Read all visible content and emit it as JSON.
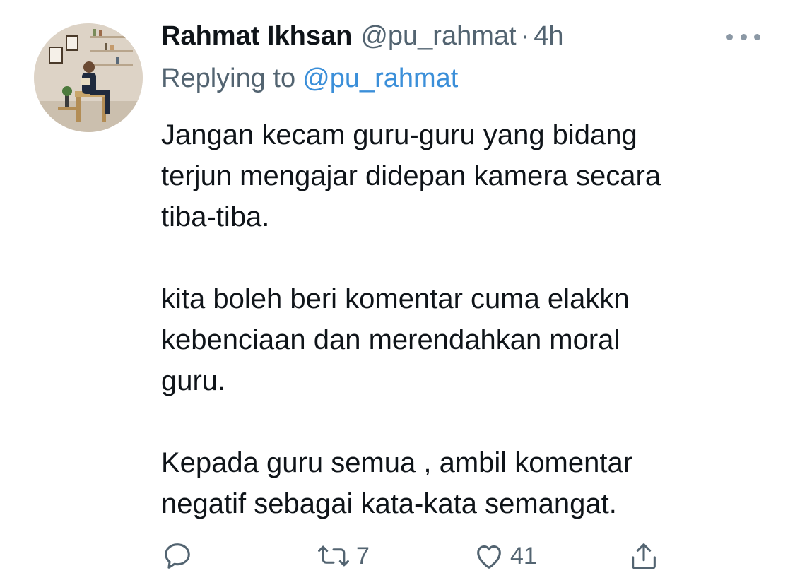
{
  "tweet": {
    "author": {
      "display_name": "Rahmat Ikhsan",
      "handle": "@pu_rahmat",
      "separator": "·",
      "timestamp": "4h"
    },
    "replying_to": {
      "label": "Replying to",
      "mention": "@pu_rahmat"
    },
    "text_lines": [
      "Jangan kecam guru-guru yang bidang",
      "terjun mengajar didepan kamera secara",
      "tiba-tiba.",
      "",
      "kita boleh beri komentar cuma elakkn",
      "kebenciaan dan merendahkan moral",
      "guru.",
      "",
      "Kepada guru semua , ambil komentar",
      "negatif sebagai kata-kata semangat."
    ],
    "actions": {
      "reply_icon": "comment-icon",
      "retweet_icon": "retweet-icon",
      "retweet_count": "7",
      "like_icon": "heart-icon",
      "like_count": "41",
      "share_icon": "share-icon"
    },
    "more_icon": "more-horizontal-icon"
  },
  "colors": {
    "primary_text": "#0f1419",
    "secondary_text": "#536471",
    "link": "#3b8fd9",
    "icon": "#536471"
  }
}
